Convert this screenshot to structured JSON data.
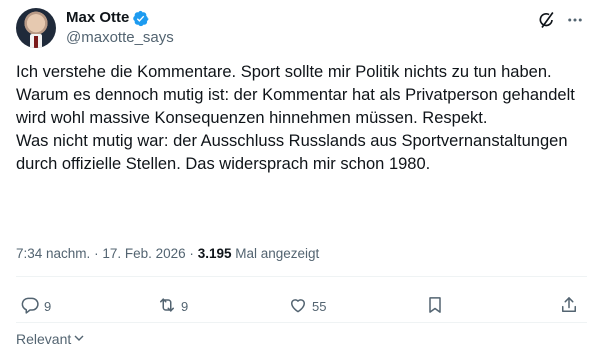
{
  "author": {
    "name": "Max Otte",
    "handle": "@maxotte_says",
    "verified": true
  },
  "tweet": {
    "text": "Ich verstehe die Kommentare. Sport sollte mir Politik nichts zu tun haben. Warum es dennoch mutig ist: der Kommentar hat als Privatperson gehandelt wird wohl massive Konsequenzen hinnehmen müssen. Respekt.\nWas nicht mutig war: der Ausschluss Russlands aus Sportvernanstaltungen durch offizielle Stellen. Das widersprach mir schon 1980.",
    "time": "7:34 nachm.",
    "date": "17. Feb. 2026",
    "views_count": "3.195",
    "views_label": "Mal angezeigt",
    "separator": "·"
  },
  "actions": {
    "replies": "9",
    "reposts": "9",
    "likes": "55"
  },
  "sort": {
    "label": "Relevant"
  },
  "colors": {
    "verified": "#1d9bf0",
    "muted": "#536471",
    "text": "#0f1419"
  },
  "icons": [
    "verified-badge-icon",
    "grok-icon",
    "more-icon",
    "reply-icon",
    "repost-icon",
    "like-icon",
    "bookmark-icon",
    "share-icon",
    "chevron-down-icon"
  ]
}
